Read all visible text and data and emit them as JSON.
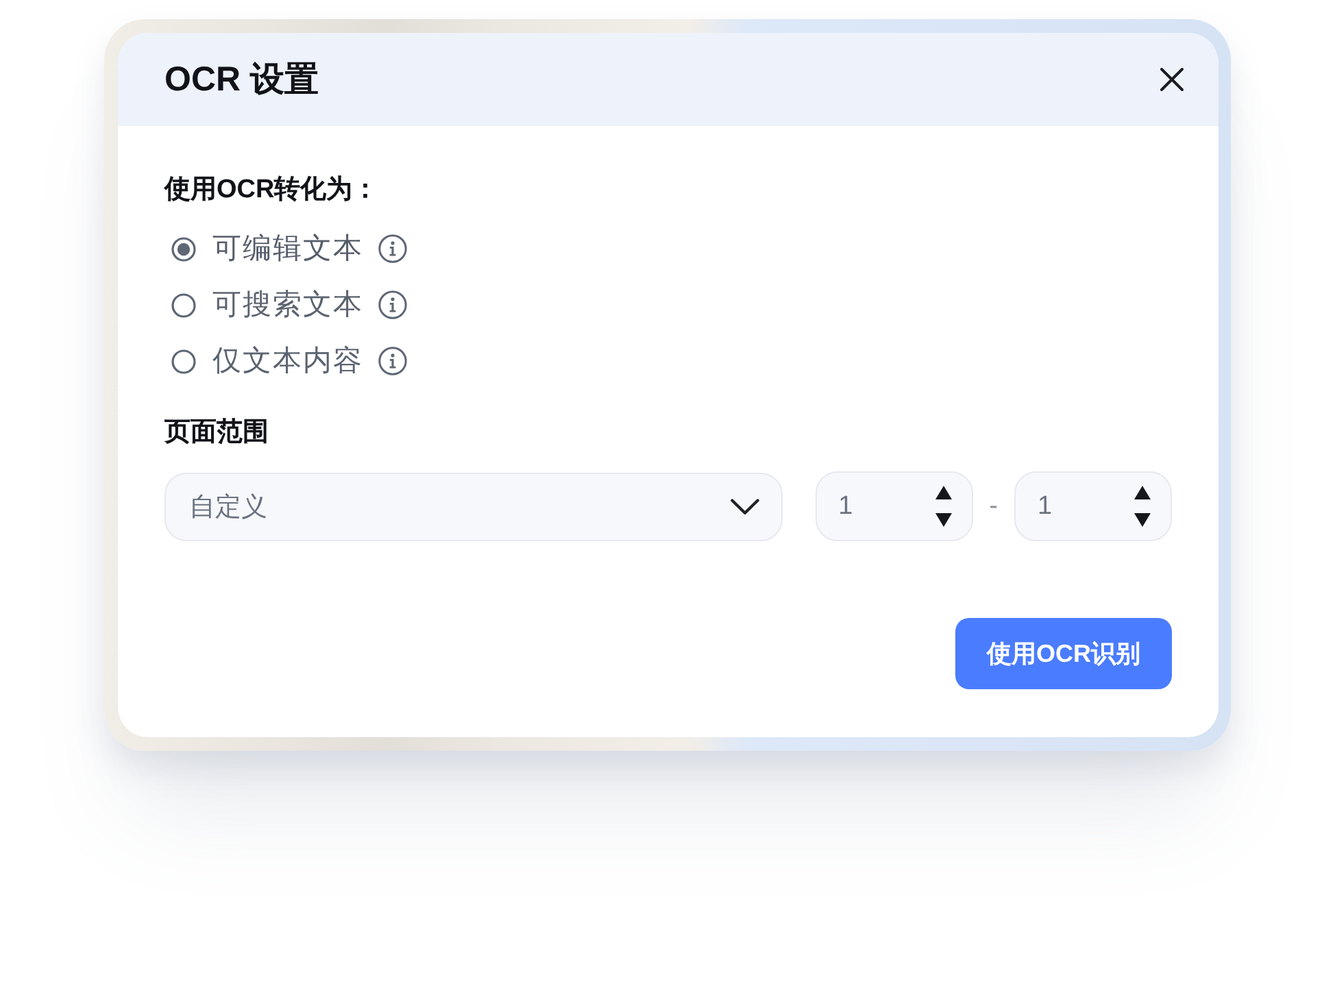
{
  "dialog": {
    "title": "OCR 设置"
  },
  "conversion": {
    "label": "使用OCR转化为：",
    "options": [
      {
        "label": "可编辑文本",
        "selected": true
      },
      {
        "label": "可搜索文本",
        "selected": false
      },
      {
        "label": "仅文本内容",
        "selected": false
      }
    ]
  },
  "page_range": {
    "label": "页面范围",
    "mode": {
      "value": "自定义"
    },
    "from": {
      "value": "1"
    },
    "separator": "-",
    "to": {
      "value": "1"
    }
  },
  "actions": {
    "primary": {
      "label": "使用OCR识别"
    }
  }
}
